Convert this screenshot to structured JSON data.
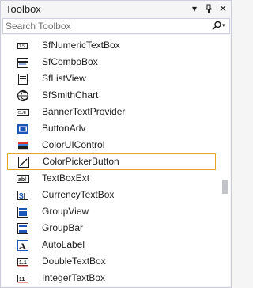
{
  "panel": {
    "title": "Toolbox",
    "dropdown_glyph": "▾",
    "pin_glyph": "⫿",
    "close_glyph": "✕"
  },
  "search": {
    "placeholder": "Search Toolbox",
    "value": "",
    "dropdown_glyph": "▾"
  },
  "items": [
    {
      "label": "SfNumericTextBox",
      "icon": "numeric-textbox-icon"
    },
    {
      "label": "SfComboBox",
      "icon": "combobox-icon"
    },
    {
      "label": "SfListView",
      "icon": "listview-icon"
    },
    {
      "label": "SfSmithChart",
      "icon": "smithchart-icon"
    },
    {
      "label": "BannerTextProvider",
      "icon": "banner-text-icon"
    },
    {
      "label": "ButtonAdv",
      "icon": "button-icon"
    },
    {
      "label": "ColorUIControl",
      "icon": "color-ui-icon"
    },
    {
      "label": "ColorPickerButton",
      "icon": "color-picker-icon"
    },
    {
      "label": "TextBoxExt",
      "icon": "textbox-icon"
    },
    {
      "label": "CurrencyTextBox",
      "icon": "currency-icon"
    },
    {
      "label": "GroupView",
      "icon": "groupview-icon"
    },
    {
      "label": "GroupBar",
      "icon": "groupbar-icon"
    },
    {
      "label": "AutoLabel",
      "icon": "autolabel-icon"
    },
    {
      "label": "DoubleTextBox",
      "icon": "double-textbox-icon"
    },
    {
      "label": "IntegerTextBox",
      "icon": "integer-textbox-icon"
    }
  ],
  "selected_index": 7,
  "colors": {
    "selection_border": "#e5a32a",
    "icon_blue": "#1e56b5",
    "icon_dark": "#1e1e1e"
  }
}
